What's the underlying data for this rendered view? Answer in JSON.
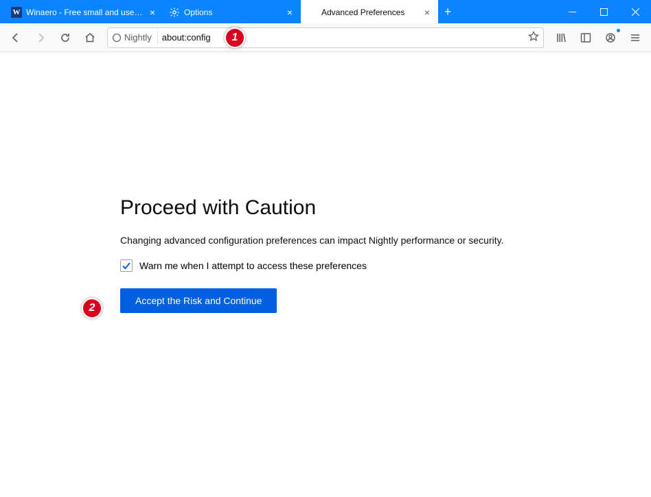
{
  "tabs": [
    {
      "label": "Winaero - Free small and usef…",
      "favicon": "w-logo"
    },
    {
      "label": "Options",
      "favicon": "gear"
    },
    {
      "label": "Advanced Preferences",
      "favicon": "none",
      "active": true
    }
  ],
  "urlbar": {
    "identity_label": "Nightly",
    "address": "about:config"
  },
  "annotations": {
    "step1": "1",
    "step2": "2"
  },
  "warning": {
    "title": "Proceed with Caution",
    "description": "Changing advanced configuration preferences can impact Nightly performance or security.",
    "checkbox_label": "Warn me when I attempt to access these preferences",
    "checkbox_checked": true,
    "accept_button": "Accept the Risk and Continue"
  }
}
